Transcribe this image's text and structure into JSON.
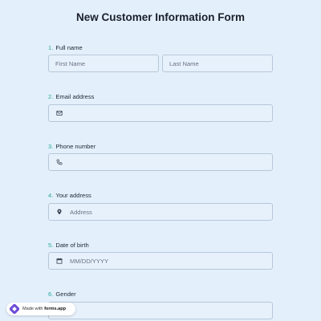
{
  "title": "New Customer Information Form",
  "questions": [
    {
      "num": "1.",
      "label": "Full name"
    },
    {
      "num": "2.",
      "label": "Email address"
    },
    {
      "num": "3.",
      "label": "Phone number"
    },
    {
      "num": "4.",
      "label": "Your address"
    },
    {
      "num": "5.",
      "label": "Date of birth"
    },
    {
      "num": "6.",
      "label": "Gender"
    }
  ],
  "fields": {
    "first_name_placeholder": "First Name",
    "last_name_placeholder": "Last Name",
    "address_placeholder": "Address",
    "dob_placeholder": "MM/DD/YYYY"
  },
  "icons": {
    "email": "envelope-icon",
    "phone": "phone-icon",
    "address": "location-pin-icon",
    "dob": "calendar-icon"
  },
  "badge": {
    "prefix": "Made with",
    "brand": "forms.app"
  },
  "colors": {
    "background": "#e3f0fc",
    "accent_number": "#27a89a",
    "field_border": "#b7c7d8"
  }
}
